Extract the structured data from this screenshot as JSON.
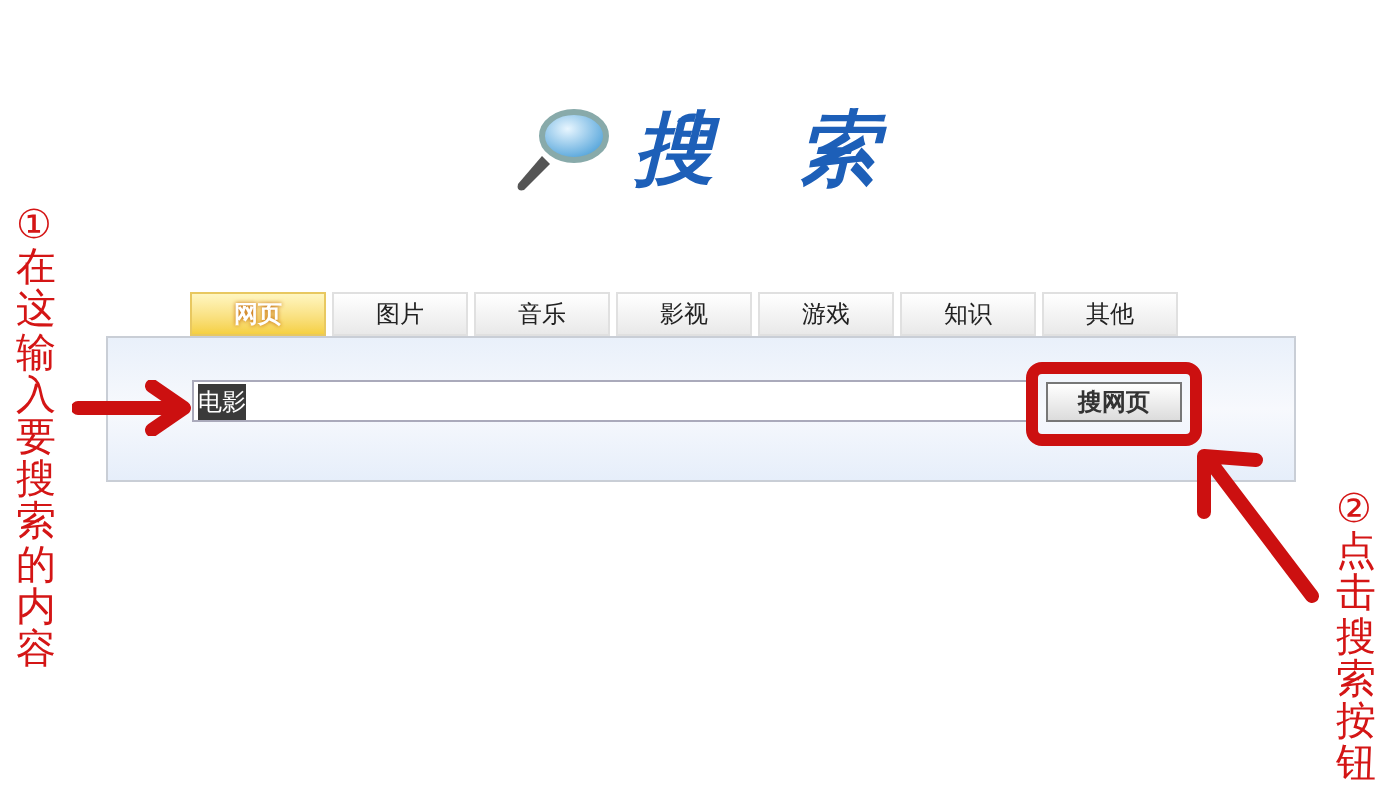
{
  "logo": {
    "characters": [
      "搜",
      "索"
    ]
  },
  "tabs": [
    {
      "label": "网页",
      "selected": true
    },
    {
      "label": "图片",
      "selected": false
    },
    {
      "label": "音乐",
      "selected": false
    },
    {
      "label": "影视",
      "selected": false
    },
    {
      "label": "游戏",
      "selected": false
    },
    {
      "label": "知识",
      "selected": false
    },
    {
      "label": "其他",
      "selected": false
    }
  ],
  "search": {
    "value": "电影",
    "text_selected": true,
    "button": "搜网页"
  },
  "annotations": [
    {
      "text": "①在这输入要搜索的内容"
    },
    {
      "text": "②点击搜索按钮"
    }
  ]
}
